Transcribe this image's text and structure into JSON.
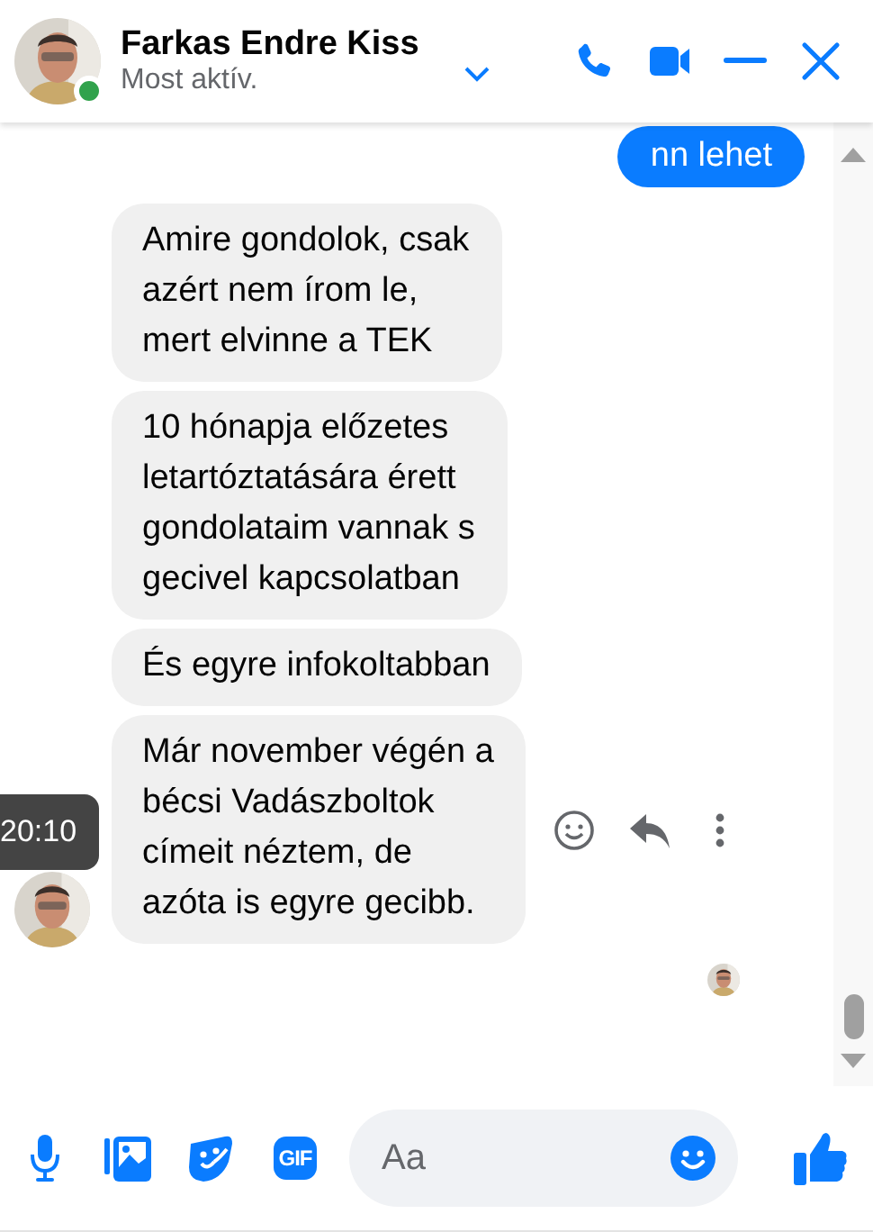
{
  "header": {
    "name": "Farkas Endre Kiss",
    "status": "Most aktív.",
    "online": true
  },
  "messages": [
    {
      "kind": "outgoing",
      "text": "nn lehet"
    },
    {
      "kind": "incoming",
      "text": "Amire gondolok, csak\nazért nem írom le,\nmert elvinne a TEK"
    },
    {
      "kind": "incoming",
      "text": "10 hónapja előzetes\nletartóztatására érett\ngondolataim vannak s\ngecivel kapcsolatban"
    },
    {
      "kind": "incoming",
      "text": "És egyre infokoltabban"
    },
    {
      "kind": "incoming",
      "text": "Már november végén a\nbécsi Vadászboltok\ncímeit néztem, de\nazóta is egyre gecibb.",
      "timestamp": "20:10",
      "hovered": true
    }
  ],
  "composer": {
    "placeholder": "Aa",
    "gif_label": "GIF"
  }
}
